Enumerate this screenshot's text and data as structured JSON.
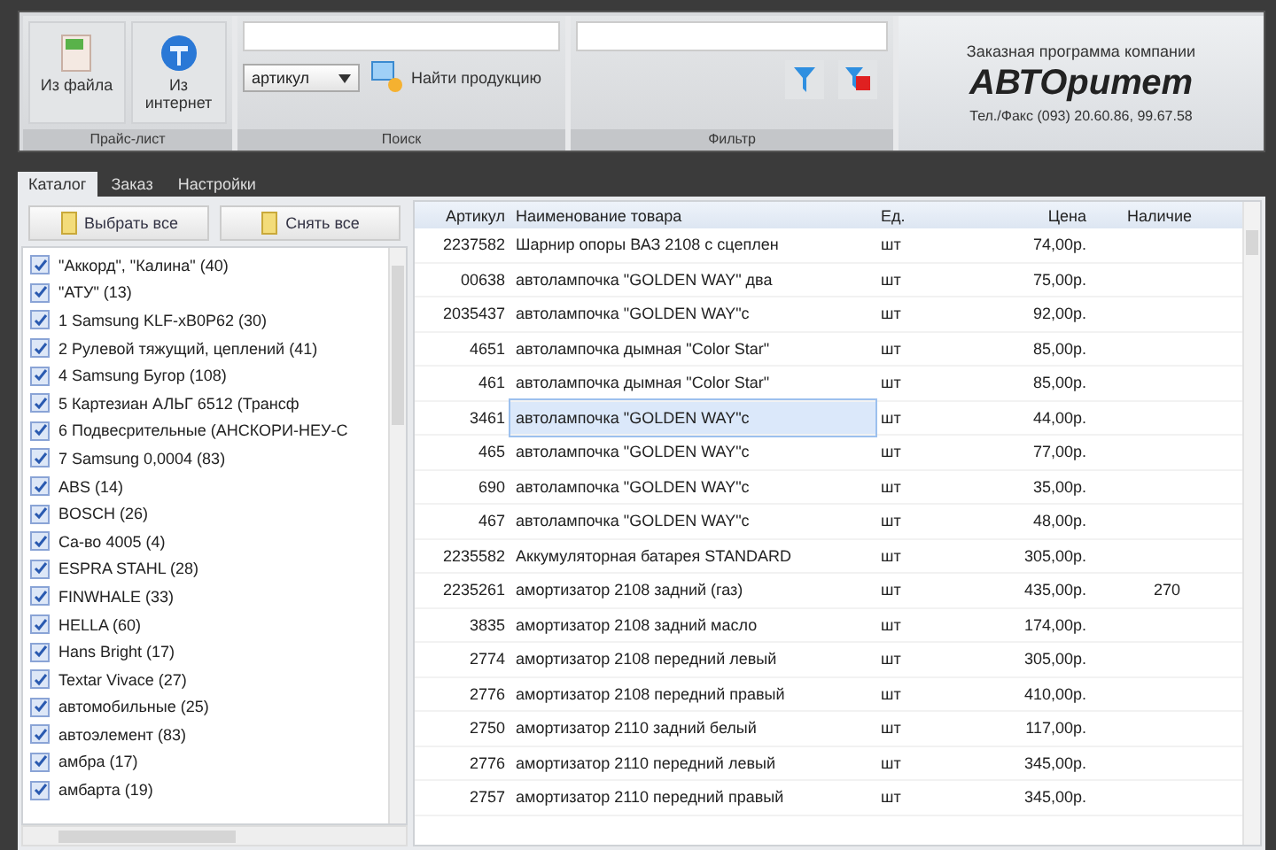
{
  "toolbar": {
    "groups": [
      {
        "kind": "import",
        "caption": "Прайс-лист",
        "buttons": [
          {
            "label": "Из файла",
            "kind": "file"
          },
          {
            "label": "Из интернет",
            "kind": "web"
          }
        ]
      },
      {
        "kind": "search",
        "caption": "Поиск",
        "dropdown": {
          "value": "артикул"
        },
        "button": {
          "label": "Найти продукцию"
        }
      },
      {
        "kind": "filter",
        "caption": "Фильтр"
      }
    ],
    "company": {
      "subtitle": "Заказная программа компании",
      "name": "АВТОритет",
      "phone": "Тел./Факс (093) 20.60.86, 99.67.58"
    }
  },
  "tabs": [
    {
      "label": "Каталог",
      "selected": true
    },
    {
      "label": "Заказ",
      "selected": false
    },
    {
      "label": "Настройки",
      "selected": false
    }
  ],
  "catalog_buttons": [
    "Выбрать все",
    "Снять все"
  ],
  "groups": [
    {
      "label": "\"Аккорд\", \"Калина\" (40)",
      "checked": true
    },
    {
      "label": "\"АТУ\" (13)",
      "checked": true
    },
    {
      "label": "1 Samsung KLF-xB0P62 (30)",
      "checked": true
    },
    {
      "label": "2 Рулевой тяжущий, цеплений (41)",
      "checked": true
    },
    {
      "label": "4 Samsung Бугор (108)",
      "checked": true
    },
    {
      "label": "5 Картезиан АЛЬГ 6512 (Трансф",
      "checked": true
    },
    {
      "label": "6 Подвесрительные (АНСКОРИ-НЕУ-С",
      "checked": true
    },
    {
      "label": "7 Samsung 0,0004 (83)",
      "checked": true
    },
    {
      "label": "ABS (14)",
      "checked": true
    },
    {
      "label": "BOSCH (26)",
      "checked": true
    },
    {
      "label": "Ca-во 4005 (4)",
      "checked": true
    },
    {
      "label": "ESPRA STAHL (28)",
      "checked": true
    },
    {
      "label": "FINWHALE (33)",
      "checked": true
    },
    {
      "label": "HELLA (60)",
      "checked": true
    },
    {
      "label": "Hans Bright (17)",
      "checked": true
    },
    {
      "label": "Textar Vivace (27)",
      "checked": true
    },
    {
      "label": "автомобильные (25)",
      "checked": true
    },
    {
      "label": "автоэлемент (83)",
      "checked": true
    },
    {
      "label": "амбра (17)",
      "checked": true
    },
    {
      "label": "амбарта (19)",
      "checked": true
    }
  ],
  "table": {
    "columns": [
      "Артикул",
      "Наименование товара",
      "Ед.",
      "Цена",
      "Наличие"
    ],
    "rows": [
      {
        "cells": [
          "2237582",
          "Шарнир опоры ВАЗ 2108 с сцеплен",
          "шт",
          "74,00р.",
          ""
        ],
        "selected": false
      },
      {
        "cells": [
          "00638",
          "автолампочка \"GOLDEN WAY\" два",
          "шт",
          "75,00р.",
          ""
        ],
        "selected": false
      },
      {
        "cells": [
          "2035437",
          "автолампочка \"GOLDEN WAY\"с",
          "шт",
          "92,00р.",
          ""
        ],
        "selected": false
      },
      {
        "cells": [
          "4651",
          "автолампочка дымная \"Color Star\"",
          "шт",
          "85,00р.",
          ""
        ],
        "selected": false
      },
      {
        "cells": [
          "461",
          "автолампочка дымная \"Color Star\"",
          "шт",
          "85,00р.",
          ""
        ],
        "selected": false
      },
      {
        "cells": [
          "3461",
          "автолампочка \"GOLDEN WAY\"с",
          "шт",
          "44,00р.",
          ""
        ],
        "selected": true
      },
      {
        "cells": [
          "465",
          "автолампочка \"GOLDEN WAY\"с",
          "шт",
          "77,00р.",
          ""
        ],
        "selected": false
      },
      {
        "cells": [
          "690",
          "автолампочка \"GOLDEN WAY\"с",
          "шт",
          "35,00р.",
          ""
        ],
        "selected": false
      },
      {
        "cells": [
          "467",
          "автолампочка \"GOLDEN WAY\"с",
          "шт",
          "48,00р.",
          ""
        ],
        "selected": false
      },
      {
        "cells": [
          "2235582",
          "Аккумуляторная батарея STANDARD",
          "шт",
          "305,00р.",
          ""
        ],
        "selected": false
      },
      {
        "cells": [
          "2235261",
          "амортизатор 2108 задний (газ)",
          "шт",
          "435,00р.",
          "270"
        ],
        "selected": false
      },
      {
        "cells": [
          "3835",
          "амортизатор 2108 задний масло",
          "шт",
          "174,00р.",
          ""
        ],
        "selected": false
      },
      {
        "cells": [
          "2774",
          "амортизатор 2108 передний левый",
          "шт",
          "305,00р.",
          ""
        ],
        "selected": false
      },
      {
        "cells": [
          "2776",
          "амортизатор 2108 передний правый",
          "шт",
          "410,00р.",
          ""
        ],
        "selected": false
      },
      {
        "cells": [
          "2750",
          "амортизатор 2110 задний белый",
          "шт",
          "117,00р.",
          ""
        ],
        "selected": false
      },
      {
        "cells": [
          "2776",
          "амортизатор 2110 передний левый",
          "шт",
          "345,00р.",
          ""
        ],
        "selected": false
      },
      {
        "cells": [
          "2757",
          "амортизатор 2110 передний правый",
          "шт",
          "345,00р.",
          ""
        ],
        "selected": false
      }
    ]
  }
}
